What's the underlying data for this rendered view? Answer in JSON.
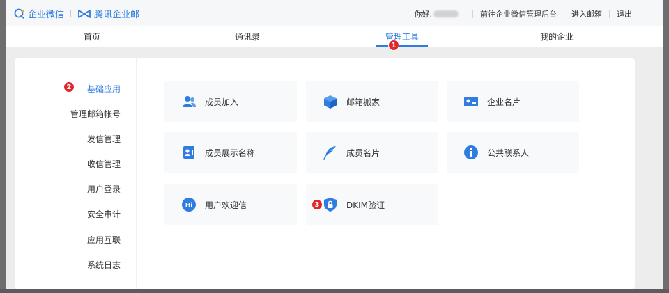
{
  "header": {
    "logo_wecom": "企业微信",
    "logo_exmail": "腾讯企业邮",
    "greeting": "你好,",
    "link_admin": "前往企业微信管理后台",
    "link_mailbox": "进入邮箱",
    "link_logout": "退出"
  },
  "nav": {
    "tabs": [
      {
        "label": "首页"
      },
      {
        "label": "通讯录"
      },
      {
        "label": "管理工具"
      },
      {
        "label": "我的企业"
      }
    ],
    "active_index": 2,
    "badge": "1"
  },
  "sidebar": {
    "badge": "2",
    "items": [
      {
        "label": "基础应用"
      },
      {
        "label": "管理邮箱帐号"
      },
      {
        "label": "发信管理"
      },
      {
        "label": "收信管理"
      },
      {
        "label": "用户登录"
      },
      {
        "label": "安全审计"
      },
      {
        "label": "应用互联"
      },
      {
        "label": "系统日志"
      }
    ]
  },
  "cards": [
    {
      "label": "成员加入",
      "icon": "user-group-icon"
    },
    {
      "label": "邮箱搬家",
      "icon": "box-icon"
    },
    {
      "label": "企业名片",
      "icon": "business-card-icon"
    },
    {
      "label": "成员展示名称",
      "icon": "contact-card-icon"
    },
    {
      "label": "成员名片",
      "icon": "feather-icon"
    },
    {
      "label": "公共联系人",
      "icon": "info-icon"
    },
    {
      "label": "用户欢迎信",
      "icon": "hi-chat-icon"
    },
    {
      "label": "DKIM验证",
      "icon": "shield-lock-icon"
    }
  ],
  "card_badge": "3",
  "colors": {
    "accent": "#2f7de1",
    "badge": "#e0282b"
  }
}
